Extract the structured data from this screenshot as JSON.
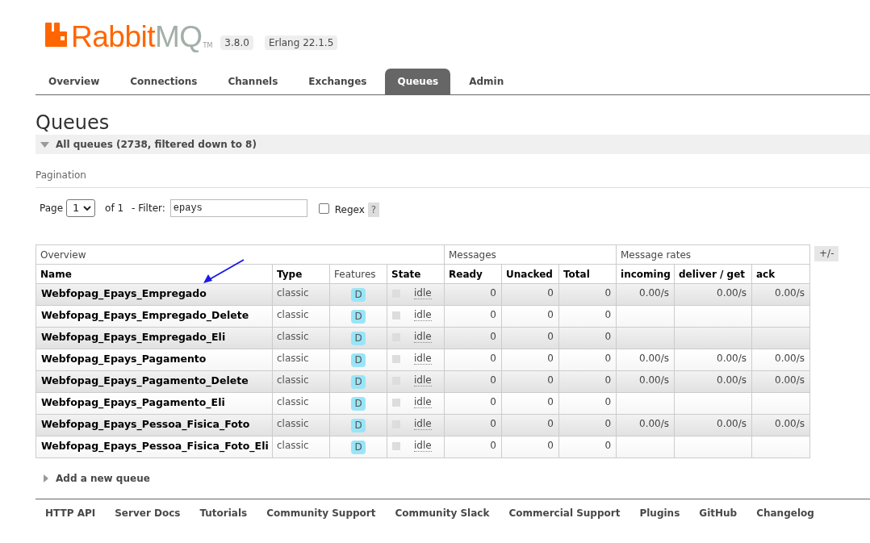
{
  "header": {
    "logo": {
      "wordmark_primary": "Rabbit",
      "wordmark_secondary": "MQ",
      "trademark": "TM"
    },
    "badges": [
      "3.8.0",
      "Erlang 22.1.5"
    ]
  },
  "tabs": [
    {
      "label": "Overview",
      "selected": false
    },
    {
      "label": "Connections",
      "selected": false
    },
    {
      "label": "Channels",
      "selected": false
    },
    {
      "label": "Exchanges",
      "selected": false
    },
    {
      "label": "Queues",
      "selected": true
    },
    {
      "label": "Admin",
      "selected": false
    }
  ],
  "page_title": "Queues",
  "queues_section": {
    "title": "All queues (2738, filtered down to 8)",
    "expanded": true
  },
  "pagination": {
    "heading": "Pagination",
    "page_label": "Page",
    "page_value": "1",
    "of_label": "of 1",
    "filter_label": "- Filter:",
    "filter_value": "epays",
    "regex_label": "Regex",
    "regex_checked": false,
    "help_label": "?"
  },
  "table": {
    "column_groups": [
      {
        "label": "Overview",
        "columns": [
          {
            "label": "Name",
            "sortable": true
          },
          {
            "label": "Type",
            "sortable": true
          },
          {
            "label": "Features",
            "sortable": false
          },
          {
            "label": "State",
            "sortable": true
          }
        ]
      },
      {
        "label": "Messages",
        "columns": [
          {
            "label": "Ready",
            "sortable": true
          },
          {
            "label": "Unacked",
            "sortable": true
          },
          {
            "label": "Total",
            "sortable": true
          }
        ]
      },
      {
        "label": "Message rates",
        "columns": [
          {
            "label": "incoming",
            "sortable": true
          },
          {
            "label": "deliver / get",
            "sortable": true
          },
          {
            "label": "ack",
            "sortable": true
          }
        ]
      }
    ],
    "rows": [
      {
        "name": "Webfopag_Epays_Empregado",
        "type": "classic",
        "features": [
          "D"
        ],
        "state": "idle",
        "ready": "0",
        "unacked": "0",
        "total": "0",
        "incoming": "0.00/s",
        "deliver_get": "0.00/s",
        "ack": "0.00/s"
      },
      {
        "name": "Webfopag_Epays_Empregado_Delete",
        "type": "classic",
        "features": [
          "D"
        ],
        "state": "idle",
        "ready": "0",
        "unacked": "0",
        "total": "0"
      },
      {
        "name": "Webfopag_Epays_Empregado_Eli",
        "type": "classic",
        "features": [
          "D"
        ],
        "state": "idle",
        "ready": "0",
        "unacked": "0",
        "total": "0"
      },
      {
        "name": "Webfopag_Epays_Pagamento",
        "type": "classic",
        "features": [
          "D"
        ],
        "state": "idle",
        "ready": "0",
        "unacked": "0",
        "total": "0",
        "incoming": "0.00/s",
        "deliver_get": "0.00/s",
        "ack": "0.00/s"
      },
      {
        "name": "Webfopag_Epays_Pagamento_Delete",
        "type": "classic",
        "features": [
          "D"
        ],
        "state": "idle",
        "ready": "0",
        "unacked": "0",
        "total": "0",
        "incoming": "0.00/s",
        "deliver_get": "0.00/s",
        "ack": "0.00/s"
      },
      {
        "name": "Webfopag_Epays_Pagamento_Eli",
        "type": "classic",
        "features": [
          "D"
        ],
        "state": "idle",
        "ready": "0",
        "unacked": "0",
        "total": "0"
      },
      {
        "name": "Webfopag_Epays_Pessoa_Fisica_Foto",
        "type": "classic",
        "features": [
          "D"
        ],
        "state": "idle",
        "ready": "0",
        "unacked": "0",
        "total": "0",
        "incoming": "0.00/s",
        "deliver_get": "0.00/s",
        "ack": "0.00/s"
      },
      {
        "name": "Webfopag_Epays_Pessoa_Fisica_Foto_Eli",
        "type": "classic",
        "features": [
          "D"
        ],
        "state": "idle",
        "ready": "0",
        "unacked": "0",
        "total": "0"
      }
    ],
    "toggle_label": "+/-"
  },
  "add_queue_section": {
    "title": "Add a new queue",
    "expanded": false
  },
  "footer_links": [
    "HTTP API",
    "Server Docs",
    "Tutorials",
    "Community Support",
    "Community Slack",
    "Commercial Support",
    "Plugins",
    "GitHub",
    "Changelog"
  ]
}
